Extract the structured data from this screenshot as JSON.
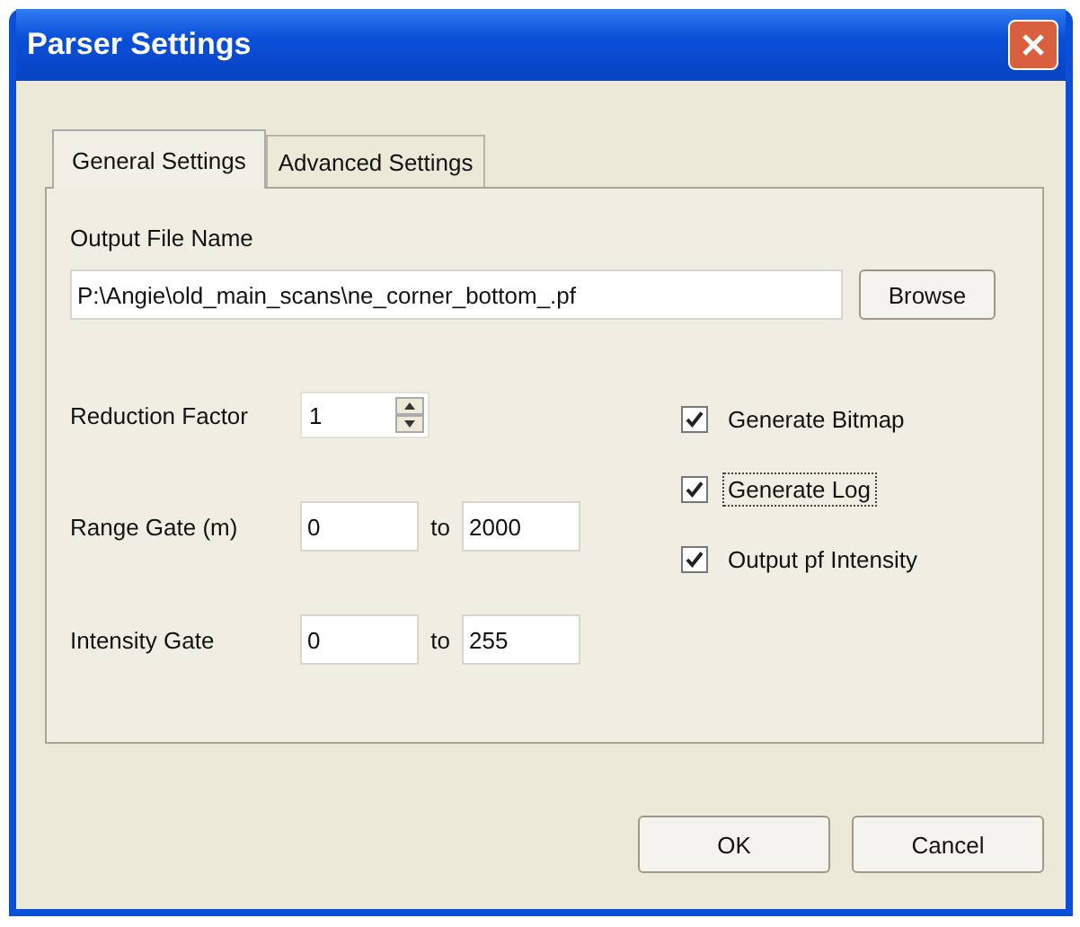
{
  "window": {
    "title": "Parser Settings"
  },
  "tabs": [
    {
      "label": "General Settings",
      "selected": true
    },
    {
      "label": "Advanced Settings",
      "selected": false
    }
  ],
  "output_file": {
    "label": "Output File Name",
    "value": "P:\\Angie\\old_main_scans\\ne_corner_bottom_.pf",
    "browse": "Browse"
  },
  "reduction_factor": {
    "label": "Reduction Factor",
    "value": "1"
  },
  "gates": [
    {
      "label": "Range Gate (m)",
      "from": "0",
      "separator": "to",
      "to": "2000"
    },
    {
      "label": "Intensity Gate",
      "from": "0",
      "separator": "to",
      "to": "255"
    }
  ],
  "options": [
    {
      "label": "Generate Bitmap",
      "checked": true,
      "focused": false
    },
    {
      "label": "Generate Log",
      "checked": true,
      "focused": true
    },
    {
      "label": "Output pf Intensity",
      "checked": true,
      "focused": false
    }
  ],
  "buttons": [
    "OK",
    "Cancel"
  ]
}
